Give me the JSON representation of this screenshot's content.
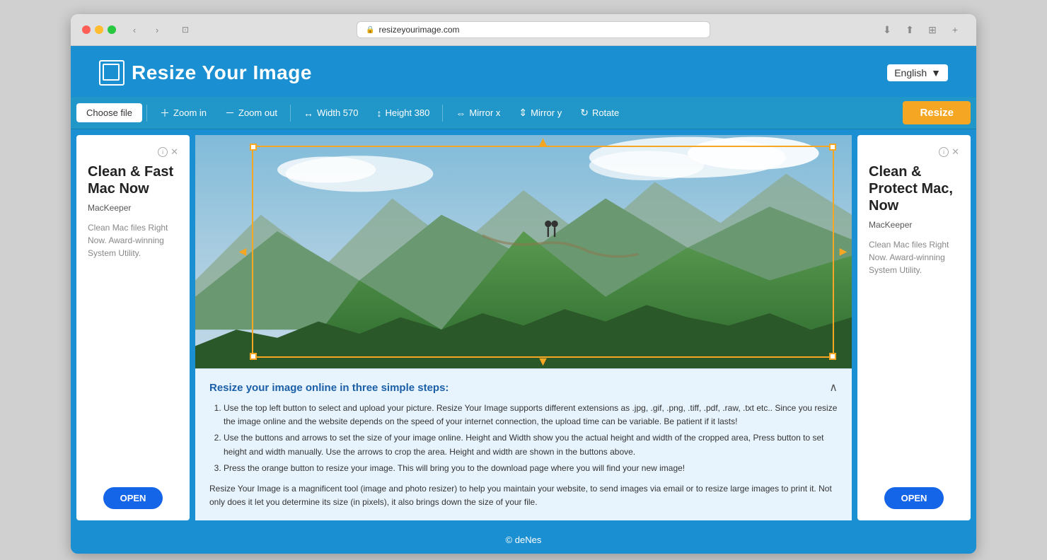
{
  "browser": {
    "url": "resizeyourimage.com",
    "url_protocol": "🔒"
  },
  "header": {
    "logo_text": "Resize Your Image",
    "language": "English"
  },
  "toolbar": {
    "choose_file": "Choose file",
    "zoom_in": "Zoom in",
    "zoom_out": "Zoom out",
    "width": "Width 570",
    "height": "Height 380",
    "mirror_x": "Mirror x",
    "mirror_y": "Mirror y",
    "rotate": "Rotate",
    "resize": "Resize"
  },
  "ads": {
    "left": {
      "title": "Clean & Fast Mac Now",
      "brand": "MacKeeper",
      "description": "Clean Mac files Right Now. Award-winning System Utility.",
      "button": "OPEN"
    },
    "right": {
      "title": "Clean & Protect Mac, Now",
      "brand": "MacKeeper",
      "description": "Clean Mac files Right Now. Award-winning System Utility.",
      "button": "OPEN"
    }
  },
  "instructions": {
    "title": "Resize your image online in three simple steps:",
    "steps": [
      "Use the top left button to select and upload your picture. Resize Your Image supports different extensions as .jpg, .gif, .png, .tiff, .pdf, .raw, .txt etc.. Since you resize the image online and the website depends on the speed of your internet connection, the upload time can be variable. Be patient if it lasts!",
      "Use the buttons and arrows to set the size of your image online. Height and Width show you the actual height and width of the cropped area, Press button to set height and width manually. Use the arrows to crop the area. Height and width are shown in the buttons above.",
      "Press the orange button to resize your image. This will bring you to the download page where you will find your new image!"
    ],
    "description": "Resize Your Image is a magnificent tool (image and photo resizer) to help you maintain your website, to send images via email or to resize large images to print it. Not only does it let you determine its size (in pixels), it also brings down the size of your file."
  },
  "footer": {
    "copyright": "© deNes"
  }
}
